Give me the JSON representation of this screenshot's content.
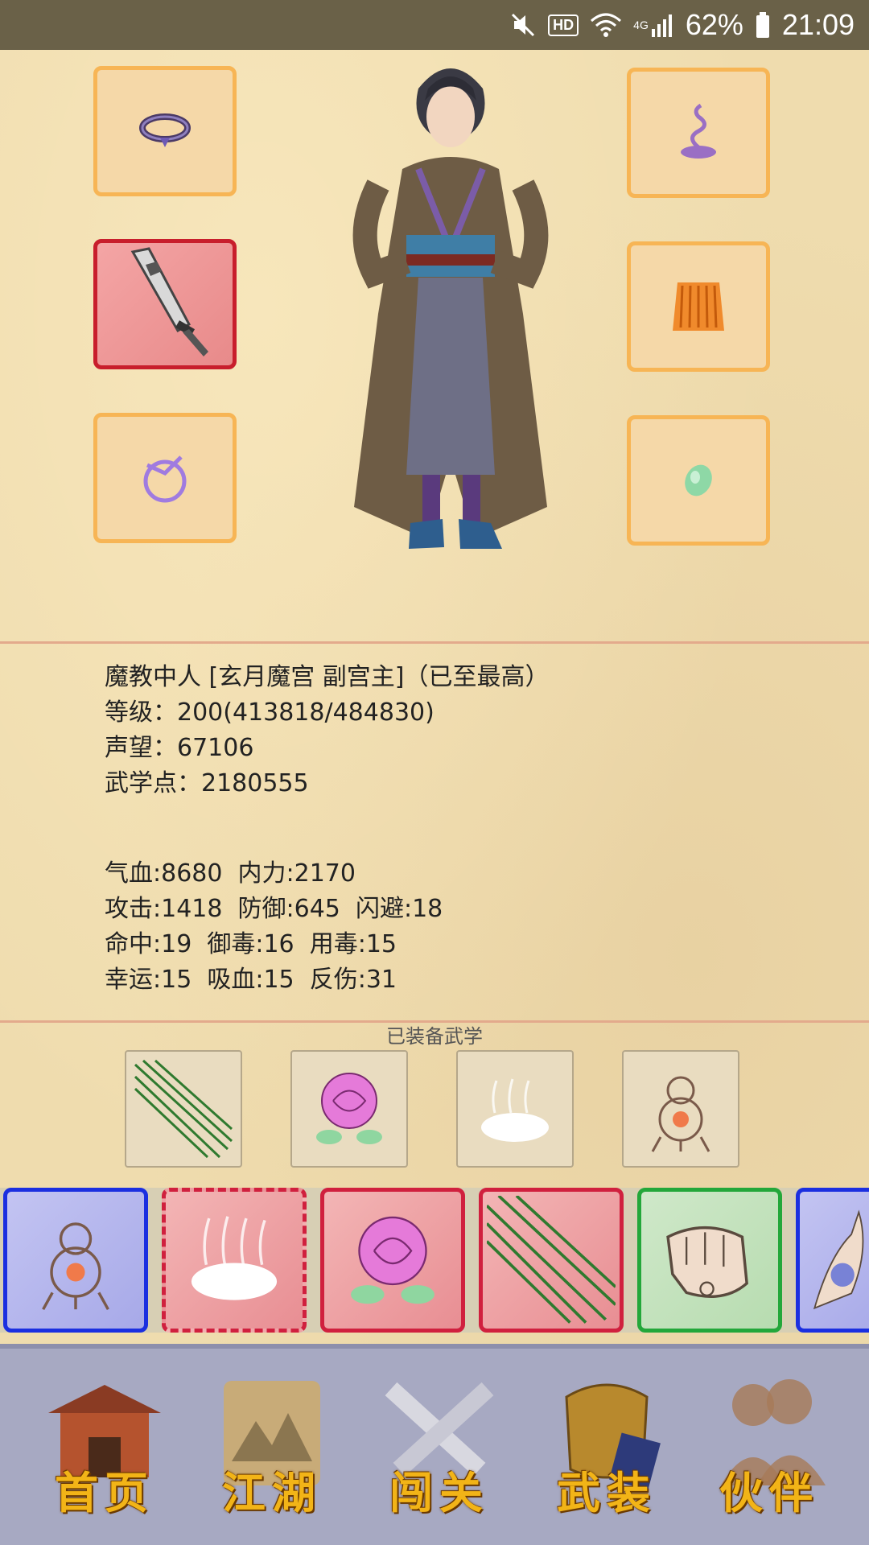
{
  "status_bar": {
    "hd": "HD",
    "network": "4G",
    "battery": "62%",
    "time": "21:09"
  },
  "character": {
    "title_line": "魔教中人 [玄月魔宫 副宫主]（已至最高）",
    "level_line": "等级：200(413818/484830)",
    "reputation_line": "声望：67106",
    "martial_points_line": "武学点：2180555"
  },
  "stats": {
    "line1": "气血:8680  内力:2170",
    "line2": "攻击:1418  防御:645  闪避:18",
    "line3": "命中:19  御毒:16  用毒:15",
    "line4": "幸运:15  吸血:15  反伤:31"
  },
  "equipped_section": {
    "label": "已装备武学"
  },
  "equipment_icons": [
    "necklace-icon",
    "sword-icon",
    "bracelet-icon",
    "incense-icon",
    "garment-icon",
    "jade-icon"
  ],
  "nav": {
    "home": "首页",
    "jianghu": "江湖",
    "challenge": "闯关",
    "equipment": "武装",
    "partner": "伙伴"
  },
  "colors": {
    "slot_border": "#f7b555",
    "slot_red_border": "#c81e2c",
    "nav_label": "#f2b417"
  }
}
